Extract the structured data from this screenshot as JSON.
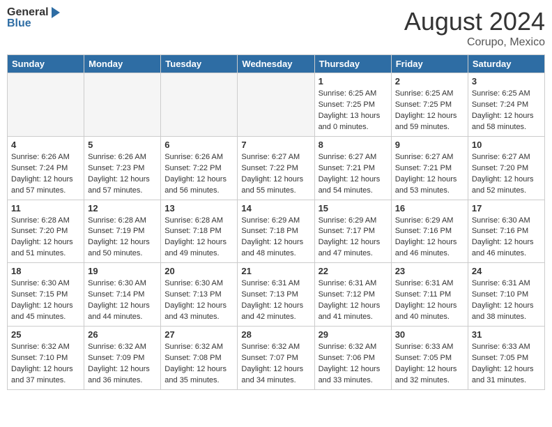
{
  "header": {
    "logo_general": "General",
    "logo_blue": "Blue",
    "month_title": "August 2024",
    "location": "Corupo, Mexico"
  },
  "weekdays": [
    "Sunday",
    "Monday",
    "Tuesday",
    "Wednesday",
    "Thursday",
    "Friday",
    "Saturday"
  ],
  "weeks": [
    [
      {
        "day": "",
        "info": ""
      },
      {
        "day": "",
        "info": ""
      },
      {
        "day": "",
        "info": ""
      },
      {
        "day": "",
        "info": ""
      },
      {
        "day": "1",
        "info": "Sunrise: 6:25 AM\nSunset: 7:25 PM\nDaylight: 13 hours\nand 0 minutes."
      },
      {
        "day": "2",
        "info": "Sunrise: 6:25 AM\nSunset: 7:25 PM\nDaylight: 12 hours\nand 59 minutes."
      },
      {
        "day": "3",
        "info": "Sunrise: 6:25 AM\nSunset: 7:24 PM\nDaylight: 12 hours\nand 58 minutes."
      }
    ],
    [
      {
        "day": "4",
        "info": "Sunrise: 6:26 AM\nSunset: 7:24 PM\nDaylight: 12 hours\nand 57 minutes."
      },
      {
        "day": "5",
        "info": "Sunrise: 6:26 AM\nSunset: 7:23 PM\nDaylight: 12 hours\nand 57 minutes."
      },
      {
        "day": "6",
        "info": "Sunrise: 6:26 AM\nSunset: 7:22 PM\nDaylight: 12 hours\nand 56 minutes."
      },
      {
        "day": "7",
        "info": "Sunrise: 6:27 AM\nSunset: 7:22 PM\nDaylight: 12 hours\nand 55 minutes."
      },
      {
        "day": "8",
        "info": "Sunrise: 6:27 AM\nSunset: 7:21 PM\nDaylight: 12 hours\nand 54 minutes."
      },
      {
        "day": "9",
        "info": "Sunrise: 6:27 AM\nSunset: 7:21 PM\nDaylight: 12 hours\nand 53 minutes."
      },
      {
        "day": "10",
        "info": "Sunrise: 6:27 AM\nSunset: 7:20 PM\nDaylight: 12 hours\nand 52 minutes."
      }
    ],
    [
      {
        "day": "11",
        "info": "Sunrise: 6:28 AM\nSunset: 7:20 PM\nDaylight: 12 hours\nand 51 minutes."
      },
      {
        "day": "12",
        "info": "Sunrise: 6:28 AM\nSunset: 7:19 PM\nDaylight: 12 hours\nand 50 minutes."
      },
      {
        "day": "13",
        "info": "Sunrise: 6:28 AM\nSunset: 7:18 PM\nDaylight: 12 hours\nand 49 minutes."
      },
      {
        "day": "14",
        "info": "Sunrise: 6:29 AM\nSunset: 7:18 PM\nDaylight: 12 hours\nand 48 minutes."
      },
      {
        "day": "15",
        "info": "Sunrise: 6:29 AM\nSunset: 7:17 PM\nDaylight: 12 hours\nand 47 minutes."
      },
      {
        "day": "16",
        "info": "Sunrise: 6:29 AM\nSunset: 7:16 PM\nDaylight: 12 hours\nand 46 minutes."
      },
      {
        "day": "17",
        "info": "Sunrise: 6:30 AM\nSunset: 7:16 PM\nDaylight: 12 hours\nand 46 minutes."
      }
    ],
    [
      {
        "day": "18",
        "info": "Sunrise: 6:30 AM\nSunset: 7:15 PM\nDaylight: 12 hours\nand 45 minutes."
      },
      {
        "day": "19",
        "info": "Sunrise: 6:30 AM\nSunset: 7:14 PM\nDaylight: 12 hours\nand 44 minutes."
      },
      {
        "day": "20",
        "info": "Sunrise: 6:30 AM\nSunset: 7:13 PM\nDaylight: 12 hours\nand 43 minutes."
      },
      {
        "day": "21",
        "info": "Sunrise: 6:31 AM\nSunset: 7:13 PM\nDaylight: 12 hours\nand 42 minutes."
      },
      {
        "day": "22",
        "info": "Sunrise: 6:31 AM\nSunset: 7:12 PM\nDaylight: 12 hours\nand 41 minutes."
      },
      {
        "day": "23",
        "info": "Sunrise: 6:31 AM\nSunset: 7:11 PM\nDaylight: 12 hours\nand 40 minutes."
      },
      {
        "day": "24",
        "info": "Sunrise: 6:31 AM\nSunset: 7:10 PM\nDaylight: 12 hours\nand 38 minutes."
      }
    ],
    [
      {
        "day": "25",
        "info": "Sunrise: 6:32 AM\nSunset: 7:10 PM\nDaylight: 12 hours\nand 37 minutes."
      },
      {
        "day": "26",
        "info": "Sunrise: 6:32 AM\nSunset: 7:09 PM\nDaylight: 12 hours\nand 36 minutes."
      },
      {
        "day": "27",
        "info": "Sunrise: 6:32 AM\nSunset: 7:08 PM\nDaylight: 12 hours\nand 35 minutes."
      },
      {
        "day": "28",
        "info": "Sunrise: 6:32 AM\nSunset: 7:07 PM\nDaylight: 12 hours\nand 34 minutes."
      },
      {
        "day": "29",
        "info": "Sunrise: 6:32 AM\nSunset: 7:06 PM\nDaylight: 12 hours\nand 33 minutes."
      },
      {
        "day": "30",
        "info": "Sunrise: 6:33 AM\nSunset: 7:05 PM\nDaylight: 12 hours\nand 32 minutes."
      },
      {
        "day": "31",
        "info": "Sunrise: 6:33 AM\nSunset: 7:05 PM\nDaylight: 12 hours\nand 31 minutes."
      }
    ]
  ]
}
